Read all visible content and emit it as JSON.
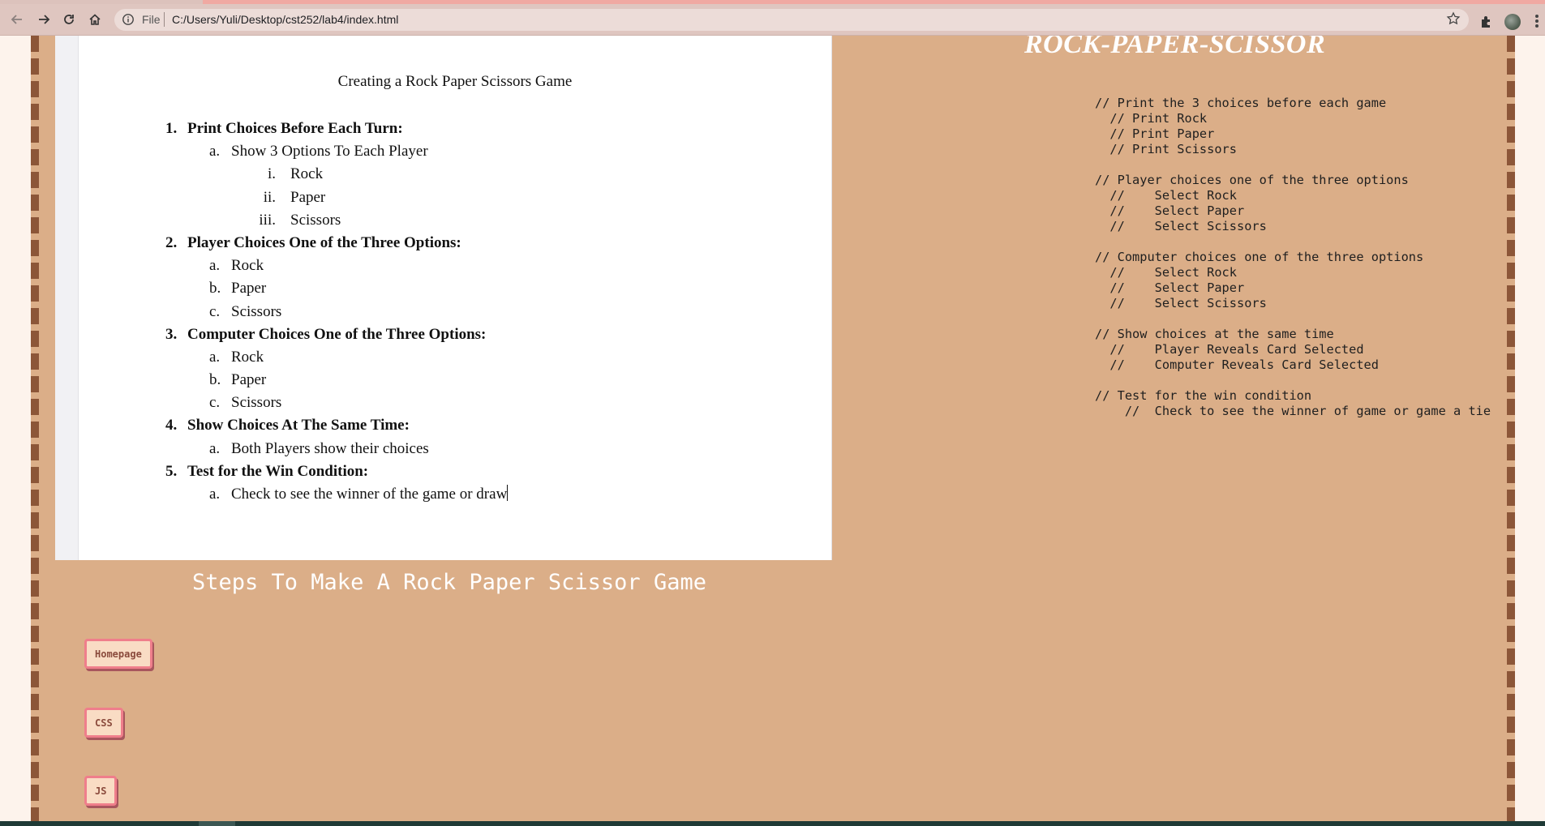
{
  "browser": {
    "address_scheme": "File",
    "address_url": "C:/Users/Yuli/Desktop/cst252/lab4/index.html",
    "icons": [
      "back-icon",
      "forward-icon",
      "reload-icon",
      "home-icon",
      "info-icon",
      "star-icon",
      "extensions-icon",
      "profile-avatar",
      "menu-icon"
    ]
  },
  "page": {
    "heading": "ROCK-PAPER-SCISSOR",
    "caption": "Steps To Make A Rock Paper Scissor Game",
    "nav_buttons": [
      "Homepage",
      "CSS",
      "JS"
    ]
  },
  "doc": {
    "title": "Creating a Rock Paper Scissors Game",
    "steps": [
      {
        "num": "1.",
        "heading": "Print Choices Before Each Turn:",
        "items": [
          {
            "marker": "a.",
            "text": "Show 3 Options To Each Player",
            "subitems": [
              {
                "marker": "i.",
                "text": "Rock"
              },
              {
                "marker": "ii.",
                "text": "Paper"
              },
              {
                "marker": "iii.",
                "text": "Scissors"
              }
            ]
          }
        ]
      },
      {
        "num": "2.",
        "heading": "Player Choices One of the Three Options:",
        "items": [
          {
            "marker": "a.",
            "text": "Rock"
          },
          {
            "marker": "b.",
            "text": "Paper"
          },
          {
            "marker": "c.",
            "text": "Scissors"
          }
        ]
      },
      {
        "num": "3.",
        "heading": "Computer Choices One of the Three Options:",
        "items": [
          {
            "marker": "a.",
            "text": "Rock"
          },
          {
            "marker": "b.",
            "text": "Paper"
          },
          {
            "marker": "c.",
            "text": "Scissors"
          }
        ]
      },
      {
        "num": "4.",
        "heading": "Show Choices At The Same Time:",
        "items": [
          {
            "marker": "a.",
            "text": "Both Players show their choices"
          }
        ]
      },
      {
        "num": "5.",
        "heading": "Test for the Win Condition:",
        "items": [
          {
            "marker": "a.",
            "text": "Check to see the winner of the game or draw"
          }
        ]
      }
    ]
  },
  "pseudocode": "// Print the 3 choices before each game\n  // Print Rock\n  // Print Paper\n  // Print Scissors\n\n// Player choices one of the three options\n  //    Select Rock\n  //    Select Paper\n  //    Select Scissors\n\n// Computer choices one of the three options\n  //    Select Rock\n  //    Select Paper\n  //    Select Scissors\n\n// Show choices at the same time\n  //    Player Reveals Card Selected\n  //    Computer Reveals Card Selected\n\n// Test for the win condition\n    //  Check to see the winner of game or game a tie",
  "colors": {
    "page_background": "#dbae88",
    "border_stripe": "#8c5638",
    "heading_text": "#ffffff",
    "button_fill": "#f9dcc4",
    "button_border": "#ef7e8b",
    "button_text": "#8a4a3c"
  }
}
